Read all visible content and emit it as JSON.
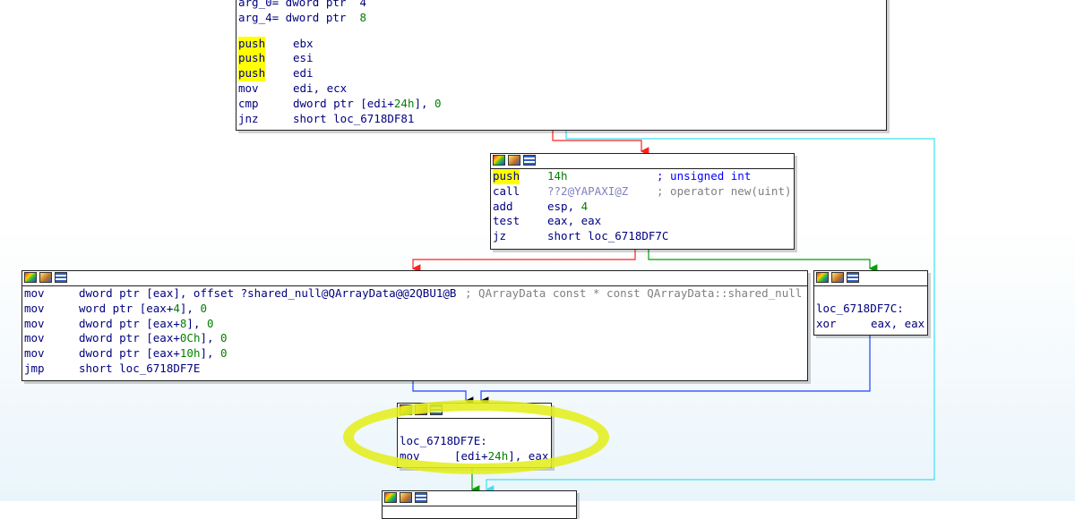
{
  "blocks": {
    "top": {
      "header": [
        {
          "text": "arg_0= dword ptr  4"
        },
        {
          "name": "arg_4= dword ptr",
          "value": "8"
        }
      ],
      "lines": [
        {
          "mn": "push",
          "op": "ebx"
        },
        {
          "mn": "push",
          "op": "esi"
        },
        {
          "mn": "push",
          "op": "edi"
        },
        {
          "mn": "mov",
          "op": "edi, ecx"
        },
        {
          "mn": "cmp",
          "op_a": "dword ptr [edi+",
          "op_num": "24h",
          "op_b": "], ",
          "op_num2": "0"
        },
        {
          "mn": "jnz",
          "op": "short loc_6718DF81"
        }
      ]
    },
    "alloc": {
      "lines": [
        {
          "mn": "push",
          "op": "14h",
          "cmt": "; unsigned int"
        },
        {
          "mn": "call",
          "op": "??2@YAPAXI@Z",
          "cmt": "; operator new(uint)"
        },
        {
          "mn": "add",
          "op_a": "esp, ",
          "op_num": "4"
        },
        {
          "mn": "test",
          "op": "eax, eax"
        },
        {
          "mn": "jz",
          "op": "short loc_6718DF7C"
        }
      ]
    },
    "init": {
      "lines": [
        {
          "mn": "mov",
          "op": "dword ptr [eax], offset ?shared_null@QArrayData@@2QBU1@B",
          "cmt": "; QArrayData const * const QArrayData::shared_null"
        },
        {
          "mn": "mov",
          "op_a": "word ptr [eax+",
          "op_num": "4",
          "op_b": "], ",
          "op_num2": "0"
        },
        {
          "mn": "mov",
          "op_a": "dword ptr [eax+",
          "op_num": "8",
          "op_b": "], ",
          "op_num2": "0"
        },
        {
          "mn": "mov",
          "op_a": "dword ptr [eax+",
          "op_num": "0Ch",
          "op_b": "], ",
          "op_num2": "0"
        },
        {
          "mn": "mov",
          "op_a": "dword ptr [eax+",
          "op_num": "10h",
          "op_b": "], ",
          "op_num2": "0"
        },
        {
          "mn": "jmp",
          "op": "short loc_6718DF7E"
        }
      ]
    },
    "zero": {
      "label": "loc_6718DF7C:",
      "lines": [
        {
          "mn": "xor",
          "op": "eax, eax"
        }
      ]
    },
    "store": {
      "label": "loc_6718DF7E:",
      "lines": [
        {
          "mn": "mov",
          "op_a": "[edi+",
          "op_num": "24h",
          "op_b": "], eax"
        }
      ]
    }
  },
  "colors": {
    "edge_true": "#ff2020",
    "edge_false": "#00a000",
    "edge_uncond": "#2040ff",
    "edge_loop": "#40e0f0",
    "highlight": "#ffff00",
    "annotation": "#e4ee1e"
  }
}
